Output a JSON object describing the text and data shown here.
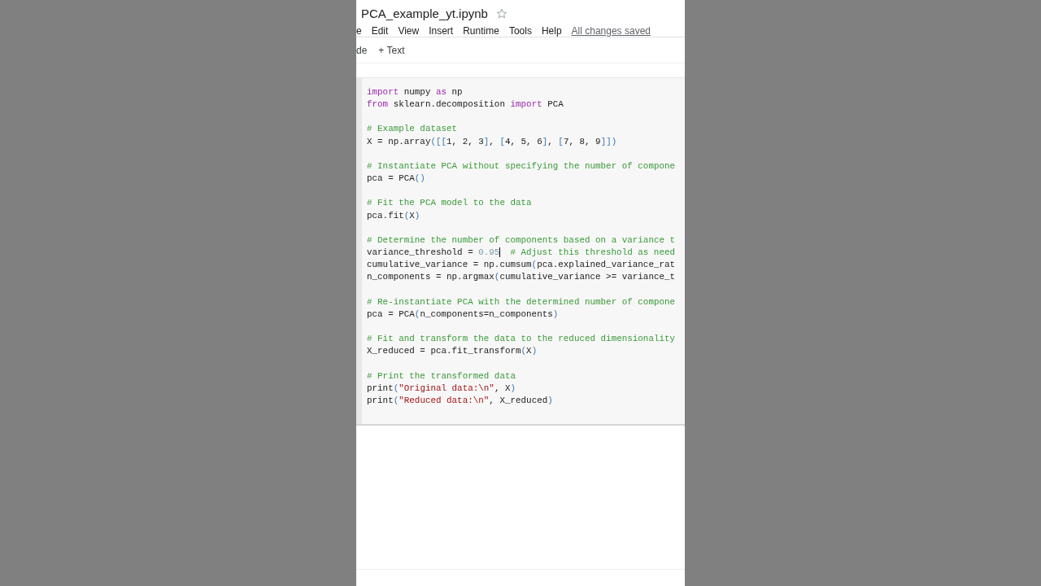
{
  "notebook": {
    "title": "PCA_example_yt.ipynb",
    "starred": false
  },
  "menu": [
    "e",
    "Edit",
    "View",
    "Insert",
    "Runtime",
    "Tools",
    "Help"
  ],
  "save_status": "All changes saved",
  "toolbar": [
    "de",
    "+ Text"
  ],
  "code_cell": {
    "lines": [
      {
        "kind": "code",
        "tokens": [
          {
            "kind": "kw",
            "t": "import"
          },
          {
            "kind": "tx",
            "t": " numpy "
          },
          {
            "kind": "kw",
            "t": "as"
          },
          {
            "kind": "tx",
            "t": " np"
          }
        ]
      },
      {
        "kind": "code",
        "tokens": [
          {
            "kind": "kw",
            "t": "from"
          },
          {
            "kind": "tx",
            "t": " sklearn.decomposition "
          },
          {
            "kind": "kw",
            "t": "import"
          },
          {
            "kind": "tx",
            "t": " PCA"
          }
        ]
      },
      {
        "kind": "blank"
      },
      {
        "kind": "code",
        "tokens": [
          {
            "kind": "cm",
            "t": "# Example dataset"
          }
        ]
      },
      {
        "kind": "code",
        "tokens": [
          {
            "kind": "tx",
            "t": "X = np.array"
          },
          {
            "kind": "br",
            "t": "([["
          },
          {
            "kind": "tx",
            "t": "1, 2, 3"
          },
          {
            "kind": "br",
            "t": "]"
          },
          {
            "kind": "tx",
            "t": ", "
          },
          {
            "kind": "br",
            "t": "["
          },
          {
            "kind": "tx",
            "t": "4, 5, 6"
          },
          {
            "kind": "br",
            "t": "]"
          },
          {
            "kind": "tx",
            "t": ", "
          },
          {
            "kind": "br",
            "t": "["
          },
          {
            "kind": "tx",
            "t": "7, 8, 9"
          },
          {
            "kind": "br",
            "t": "]])"
          }
        ]
      },
      {
        "kind": "blank"
      },
      {
        "kind": "code",
        "tokens": [
          {
            "kind": "cm",
            "t": "# Instantiate PCA without specifying the number of compone"
          }
        ]
      },
      {
        "kind": "code",
        "tokens": [
          {
            "kind": "tx",
            "t": "pca = PCA"
          },
          {
            "kind": "br",
            "t": "()"
          }
        ]
      },
      {
        "kind": "blank"
      },
      {
        "kind": "code",
        "tokens": [
          {
            "kind": "cm",
            "t": "# Fit the PCA model to the data"
          }
        ]
      },
      {
        "kind": "code",
        "tokens": [
          {
            "kind": "tx",
            "t": "pca.fit"
          },
          {
            "kind": "br",
            "t": "("
          },
          {
            "kind": "tx",
            "t": "X"
          },
          {
            "kind": "br",
            "t": ")"
          }
        ]
      },
      {
        "kind": "blank"
      },
      {
        "kind": "code",
        "tokens": [
          {
            "kind": "cm",
            "t": "# Determine the number of components based on a variance t"
          }
        ]
      },
      {
        "kind": "code",
        "tokens": [
          {
            "kind": "tx",
            "t": "variance_threshold = "
          },
          {
            "kind": "num",
            "t": "0.95",
            "caret": true
          },
          {
            "kind": "cm",
            "t": "# Adjust this threshold as need"
          }
        ]
      },
      {
        "kind": "code",
        "tokens": [
          {
            "kind": "tx",
            "t": "cumulative_variance = np.cumsum"
          },
          {
            "kind": "br",
            "t": "("
          },
          {
            "kind": "tx",
            "t": "pca.explained_variance_rat"
          }
        ]
      },
      {
        "kind": "code",
        "tokens": [
          {
            "kind": "tx",
            "t": "n_components = np.argmax"
          },
          {
            "kind": "br",
            "t": "("
          },
          {
            "kind": "tx",
            "t": "cumulative_variance >= variance_t"
          }
        ]
      },
      {
        "kind": "blank"
      },
      {
        "kind": "code",
        "tokens": [
          {
            "kind": "cm",
            "t": "# Re-instantiate PCA with the determined number of compone"
          }
        ]
      },
      {
        "kind": "code",
        "tokens": [
          {
            "kind": "tx",
            "t": "pca = PCA"
          },
          {
            "kind": "br",
            "t": "("
          },
          {
            "kind": "tx",
            "t": "n_components=n_components"
          },
          {
            "kind": "br",
            "t": ")"
          }
        ]
      },
      {
        "kind": "blank"
      },
      {
        "kind": "code",
        "tokens": [
          {
            "kind": "cm",
            "t": "# Fit and transform the data to the reduced dimensionality"
          }
        ]
      },
      {
        "kind": "code",
        "tokens": [
          {
            "kind": "tx",
            "t": "X_reduced = pca.fit_transform"
          },
          {
            "kind": "br",
            "t": "("
          },
          {
            "kind": "tx",
            "t": "X"
          },
          {
            "kind": "br",
            "t": ")"
          }
        ]
      },
      {
        "kind": "blank"
      },
      {
        "kind": "code",
        "tokens": [
          {
            "kind": "cm",
            "t": "# Print the transformed data"
          }
        ]
      },
      {
        "kind": "code",
        "tokens": [
          {
            "kind": "tx",
            "t": "print"
          },
          {
            "kind": "br",
            "t": "("
          },
          {
            "kind": "str",
            "t": "\"Original data:\\n\""
          },
          {
            "kind": "tx",
            "t": ", X"
          },
          {
            "kind": "br",
            "t": ")"
          }
        ]
      },
      {
        "kind": "code",
        "tokens": [
          {
            "kind": "tx",
            "t": "print"
          },
          {
            "kind": "br",
            "t": "("
          },
          {
            "kind": "str",
            "t": "\"Reduced data:\\n\""
          },
          {
            "kind": "tx",
            "t": ", X_reduced"
          },
          {
            "kind": "br",
            "t": ")"
          }
        ]
      }
    ]
  }
}
